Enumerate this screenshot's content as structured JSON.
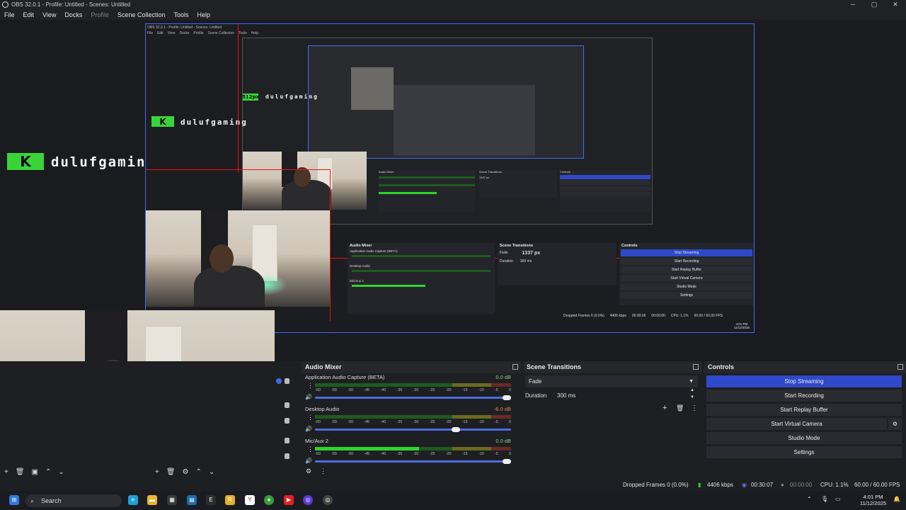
{
  "window": {
    "title": "OBS 32.0.1 - Profile: Untitled - Scenes: Untitled",
    "min": "─",
    "max": "▢",
    "close": "✕"
  },
  "menu": {
    "file": "File",
    "edit": "Edit",
    "view": "View",
    "docks": "Docks",
    "profile": "Profile",
    "scene_collection": "Scene Collection",
    "tools": "Tools",
    "help": "Help"
  },
  "preview": {
    "logo_text": "dulufgaming",
    "logo_mark": "K",
    "px_badge_1": "512px",
    "px_badge_2": "1337 px",
    "nested_title": "OBS 32.0.1 - Profile: Untitled - Scenes: Untitled",
    "nested_menu": [
      "File",
      "Edit",
      "View",
      "Docks",
      "Profile",
      "Scene Collection",
      "Tools",
      "Help"
    ],
    "nested": {
      "audio_mixer": "Audio Mixer",
      "scene_transitions": "Scene Transitions",
      "controls": "Controls",
      "app_audio": "Application Audio Capture (BETA)",
      "desktop_audio": "Desktop Audio",
      "mic_aux": "Mic/Aux 2",
      "db0": "0.0 dB",
      "db_desktop": "-6.0 dB",
      "fade": "Fade",
      "duration_label": "Duration",
      "duration_value": "300 ms",
      "stop_streaming": "Stop Streaming",
      "start_recording": "Start Recording",
      "start_replay": "Start Replay Buffer",
      "start_virtual": "Start Virtual Camera",
      "studio_mode": "Studio Mode",
      "settings": "Settings",
      "status": "Dropped Frames 0 (0.0%)",
      "kbps": "4406 kbps",
      "time": "00:30:06",
      "rec_time": "00:00:00",
      "cpu": "CPU: 1.1%",
      "fps": "60.00 / 60.00 FPS",
      "clock_time": "4:01 PM",
      "clock_date": "11/12/2025"
    }
  },
  "audio_mixer": {
    "title": "Audio Mixer",
    "channels": [
      {
        "name": "Application Audio Capture (BETA)",
        "db": "0.0 dB",
        "db_color": "#8fd18f",
        "level": 0.0,
        "volume": 1.0
      },
      {
        "name": "Desktop Audio",
        "db": "-6.0 dB",
        "db_color": "#e08a5a",
        "level": 0.0,
        "volume": 0.74
      },
      {
        "name": "Mic/Aux 2",
        "db": "0.0 dB",
        "db_color": "#8fd18f",
        "level": 0.53,
        "volume": 1.0
      }
    ],
    "ticks": [
      "-60",
      "-55",
      "-50",
      "-45",
      "-40",
      "-35",
      "-30",
      "-25",
      "-20",
      "-15",
      "-10",
      "-5",
      "0"
    ]
  },
  "scene_transitions": {
    "title": "Scene Transitions",
    "transition": "Fade",
    "duration_label": "Duration",
    "duration_value": "300 ms",
    "add": "+",
    "remove": "🗑",
    "more": "⋮"
  },
  "controls": {
    "title": "Controls",
    "stop_streaming": "Stop Streaming",
    "start_recording": "Start Recording",
    "start_replay": "Start Replay Buffer",
    "start_virtual": "Start Virtual Camera",
    "studio_mode": "Studio Mode",
    "settings": "Settings"
  },
  "statusbar": {
    "dropped": "Dropped Frames 0 (0.0%)",
    "kbps": "4406 kbps",
    "stream_time": "00:30:07",
    "rec_time": "00:00:00",
    "cpu": "CPU: 1.1%",
    "fps": "60.00 / 60.00 FPS"
  },
  "taskbar": {
    "search_placeholder": "Search",
    "time": "4:01 PM",
    "date": "11/12/2025"
  },
  "colors": {
    "accent": "#2f49c9",
    "meter_green": "#2fd42f",
    "nested_border": "#3b6cff",
    "selection_red": "#e11111"
  }
}
